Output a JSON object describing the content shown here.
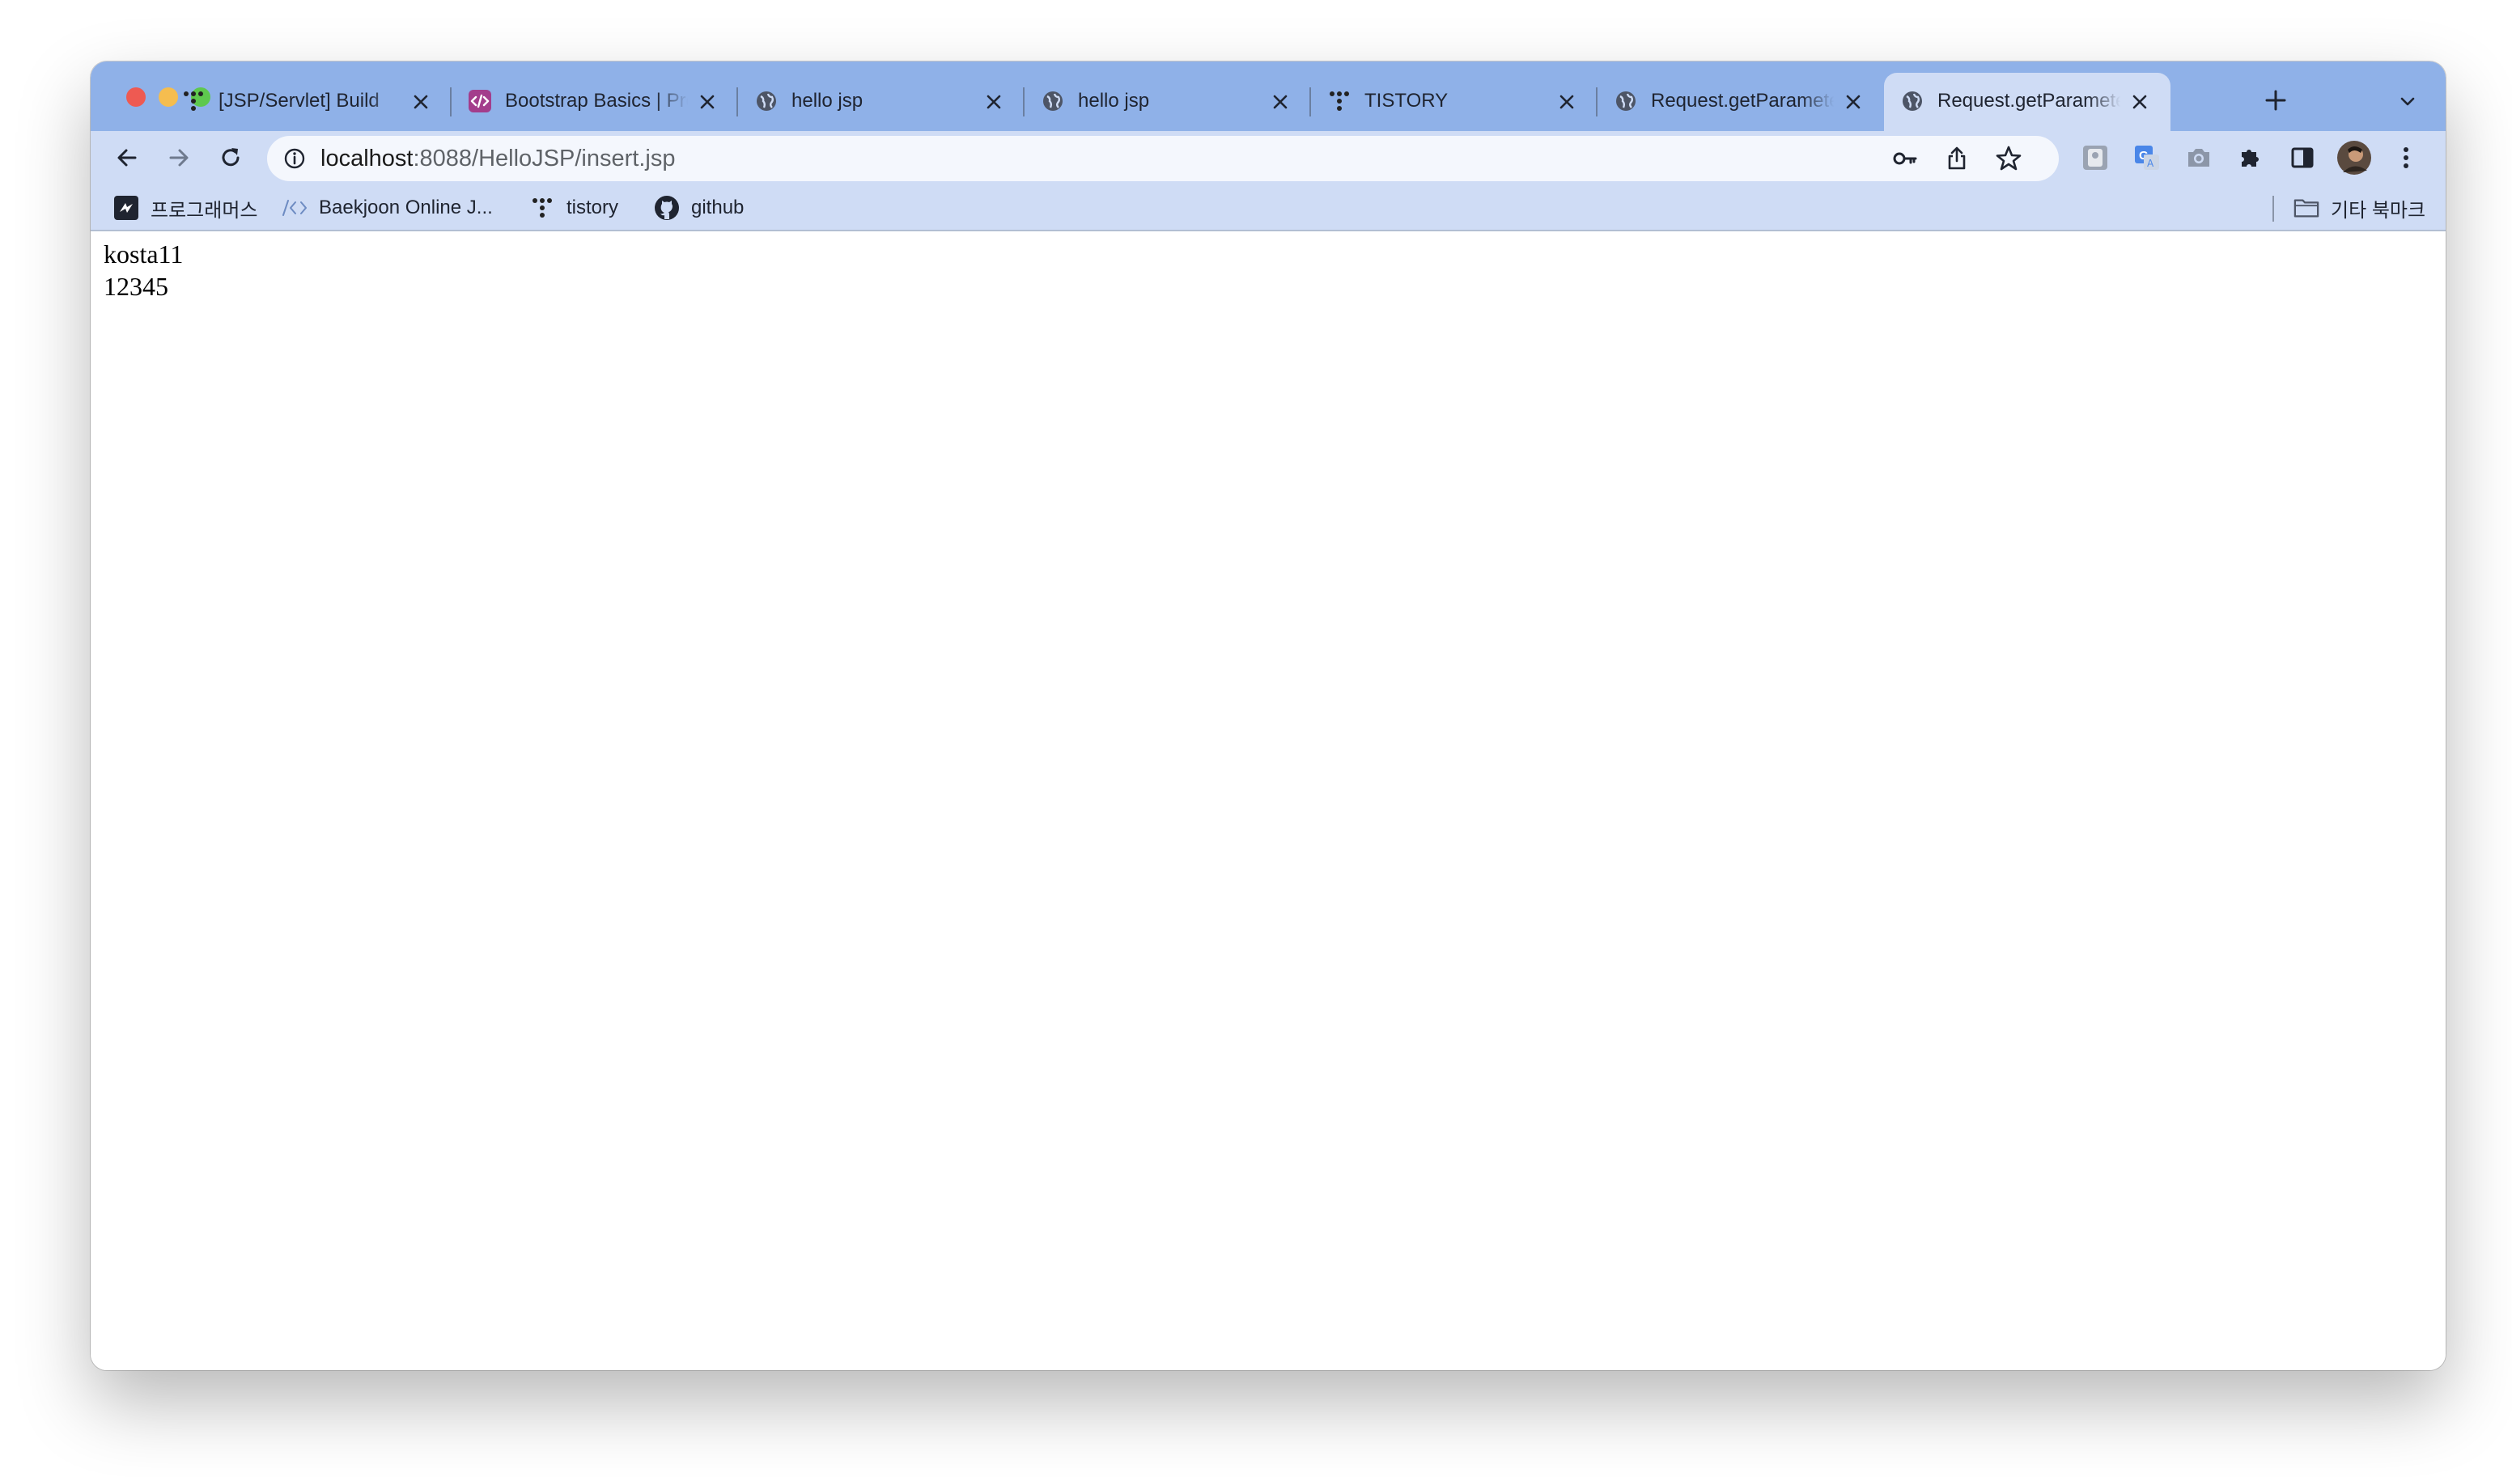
{
  "browser": {
    "tabs": [
      {
        "title": "[JSP/Servlet] Build",
        "favicon": "tistory-icon",
        "active": false
      },
      {
        "title": "Bootstrap Basics | Programiz",
        "favicon": "code-icon",
        "active": false
      },
      {
        "title": "hello jsp",
        "favicon": "globe-icon",
        "active": false
      },
      {
        "title": "hello jsp",
        "favicon": "globe-icon",
        "active": false
      },
      {
        "title": "TISTORY",
        "favicon": "tistory-icon",
        "active": false
      },
      {
        "title": "Request.getParameter",
        "favicon": "globe-icon",
        "active": false
      },
      {
        "title": "Request.getParameter",
        "favicon": "globe-icon",
        "active": true
      }
    ],
    "address": {
      "host": "localhost",
      "rest": ":8088/HelloJSP/insert.jsp"
    },
    "bookmarks": [
      {
        "label": "프로그래머스",
        "icon": "programmers-icon"
      },
      {
        "label": "Baekjoon Online J...",
        "icon": "code-brackets-icon"
      },
      {
        "label": "tistory",
        "icon": "tistory-icon"
      },
      {
        "label": "github",
        "icon": "github-icon"
      }
    ],
    "other_bookmarks": {
      "label": "기타 북마크",
      "icon": "folder-icon"
    }
  },
  "page": {
    "lines": [
      "kosta11",
      "12345"
    ]
  }
}
